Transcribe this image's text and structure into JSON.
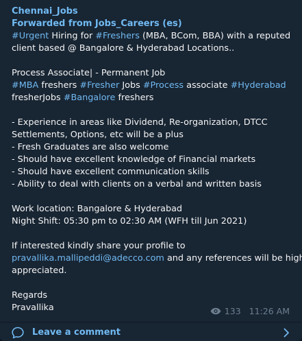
{
  "post": {
    "channel": "Chennai_Jobs",
    "forwarded": "Forwarded from Jobs_Careers (es)",
    "l1": {
      "tag1": "#Urgent",
      "t1": " Hiring for ",
      "tag2": "#Freshers",
      "t2": " (MBA, BCom, BBA) with a reputed"
    },
    "l2": "client based @ Bangalore & Hyderabad Locations..",
    "l3": "Process Associate| - Permanent Job",
    "l4": {
      "tag1": "#MBA",
      "t1": " freshers ",
      "tag2": "#Fresher",
      "t2": " Jobs ",
      "tag3": "#Process",
      "t3": " associate ",
      "tag4": "#Hyderabad"
    },
    "l5": {
      "t1": "fresherJobs ",
      "tag1": "#Bangalore",
      "t2": " freshers"
    },
    "l6": "- Experience in areas like Dividend, Re-organization, DTCC",
    "l7": "Settlements, Options, etc will be a plus",
    "l8": "- Fresh Graduates are also welcome",
    "l9": "- Should have excellent knowledge of Financial markets",
    "l10": "- Should have excellent communication skills",
    "l11": "- Ability to deal with clients on a verbal and written basis",
    "l12": "Work location: Bangalore & Hyderabad",
    "l13": "Night Shift: 05:30 pm to 02:30 AM (WFH till Jun 2021)",
    "l14": "If interested kindly share your profile to",
    "l15": {
      "email": "pravallika.mallipeddi@adecco.com",
      "t1": " and any references will be highly"
    },
    "l16": "appreciated.",
    "l17": "Regards",
    "l18": "Pravallika"
  },
  "meta": {
    "views": "133",
    "time": "11:26 AM",
    "icon": "eye-icon"
  },
  "comment": {
    "label": "Leave a comment",
    "icon": "comment-icon",
    "chevron": "chevron-right-icon"
  },
  "colors": {
    "accent": "#71baf2",
    "bubble": "#182533",
    "text": "#f5f5f5",
    "muted": "#6d7f8f"
  }
}
